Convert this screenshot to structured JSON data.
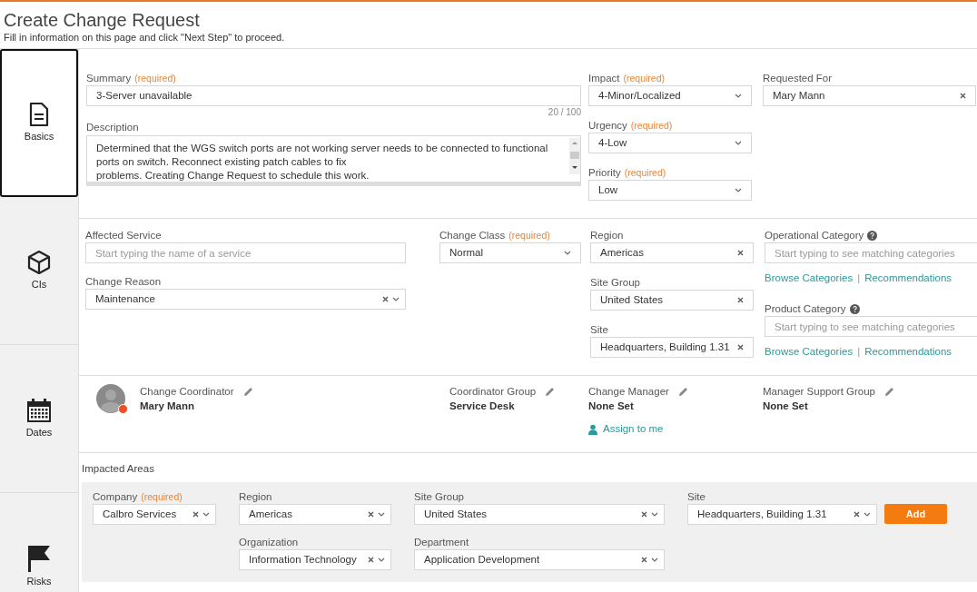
{
  "header": {
    "title": "Create Change Request",
    "subtitle": "Fill in information on this page and click \"Next Step\" to proceed."
  },
  "nav": [
    {
      "label": "Basics",
      "kind": "document",
      "selected": true
    },
    {
      "label": "CIs",
      "kind": "cube",
      "selected": false
    },
    {
      "label": "Dates",
      "kind": "calendar",
      "selected": false
    },
    {
      "label": "Risks",
      "kind": "flag",
      "selected": false
    }
  ],
  "basics": {
    "summary": {
      "label": "Summary",
      "note": "(required)",
      "value": "3-Server unavailable",
      "counter": "20 / 100"
    },
    "description": {
      "label": "Description",
      "lines": [
        "Determined that the WGS switch ports are not working server needs to be connected to functional ports on switch.  Reconnect existing patch cables to fix",
        "problems.  Creating Change Request to schedule this work."
      ]
    },
    "middle": [
      {
        "label": "Impact",
        "note": "(required)",
        "value": "4-Minor/Localized",
        "kind": "select"
      },
      {
        "label": "Urgency",
        "note": "(required)",
        "value": "4-Low",
        "kind": "select"
      },
      {
        "label": "Priority",
        "note": "(required)",
        "value": "Low",
        "kind": "select"
      }
    ],
    "right": [
      {
        "label": "Requested For",
        "value": "Mary Mann",
        "kind": "clear"
      }
    ]
  },
  "classification": {
    "left": [
      {
        "label": "Affected Service",
        "placeholder": "Start typing the name of a service",
        "kind": "input"
      },
      {
        "label": "Change Reason",
        "value": "Maintenance",
        "kind": "clear_select"
      }
    ],
    "class": {
      "label": "Change Class",
      "note": "(required)",
      "value": "Normal",
      "kind": "select"
    },
    "middle": [
      {
        "label": "Region",
        "value": "Americas",
        "kind": "clear"
      },
      {
        "label": "Site Group",
        "value": "United States",
        "kind": "clear"
      },
      {
        "label": "Site",
        "value": "Headquarters, Building 1.31",
        "kind": "clear"
      }
    ],
    "right": [
      {
        "label": "Operational Category",
        "help": true,
        "placeholder": "Start typing to see matching categories",
        "kind": "input",
        "links": [
          "Browse Categories",
          "Recommendations"
        ],
        "separator": "|"
      },
      {
        "label": "Product Category",
        "help": true,
        "placeholder": "Start typing to see matching categories",
        "kind": "input",
        "links": [
          "Browse Categories",
          "Recommendations"
        ],
        "separator": "|"
      }
    ]
  },
  "people": [
    {
      "label": "Change Coordinator",
      "value": "Mary Mann",
      "avatar": true,
      "color": "#f04e23"
    },
    {
      "label": "Coordinator Group",
      "value": "Service Desk"
    },
    {
      "label": "Change Manager",
      "value": "None Set",
      "action": "Assign to me"
    },
    {
      "label": "Manager Support Group",
      "value": "None Set"
    }
  ],
  "impacted": {
    "title": "Impacted Areas",
    "add_button": "Add",
    "rows": [
      [
        {
          "label": "Company",
          "note": "(required)",
          "value": "Calbro Services",
          "kind": "clear_select"
        },
        {
          "label": "Region",
          "value": "Americas",
          "kind": "clear_select"
        },
        {
          "label": "Site Group",
          "value": "United States",
          "kind": "clear_select"
        },
        {
          "label": "Site",
          "value": "Headquarters, Building 1.31",
          "kind": "clear_select"
        }
      ],
      [
        "",
        {
          "label": "Organization",
          "value": "Information Technology",
          "kind": "clear_select"
        },
        {
          "label": "Department",
          "value": "Application Development",
          "kind": "clear_select"
        }
      ]
    ]
  }
}
